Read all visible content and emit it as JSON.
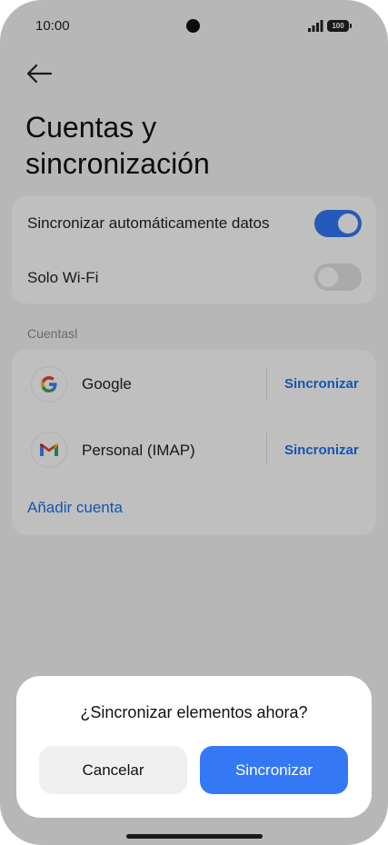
{
  "status_bar": {
    "time": "10:00",
    "battery": "100"
  },
  "header": {
    "back_icon": "arrow-left-icon",
    "title_line1": "Cuentas y",
    "title_line2": "sincronización"
  },
  "sync_settings": {
    "auto_sync_label": "Sincronizar automáticamente datos",
    "auto_sync_on": true,
    "wifi_only_label": "Solo Wi-Fi",
    "wifi_only_on": false
  },
  "accounts_section": {
    "header": "Cuentasl",
    "accounts": [
      {
        "name": "Google",
        "icon": "google-icon",
        "sync_label": "Sincronizar"
      },
      {
        "name": "Personal (IMAP)",
        "icon": "gmail-icon",
        "sync_label": "Sincronizar"
      }
    ],
    "add_account_label": "Añadir cuenta"
  },
  "dialog": {
    "title": "¿Sincronizar elementos ahora?",
    "cancel_label": "Cancelar",
    "confirm_label": "Sincronizar"
  },
  "colors": {
    "accent": "#3478f6",
    "link": "#1e72e8",
    "overlay": "rgba(0,0,0,0.25)"
  }
}
